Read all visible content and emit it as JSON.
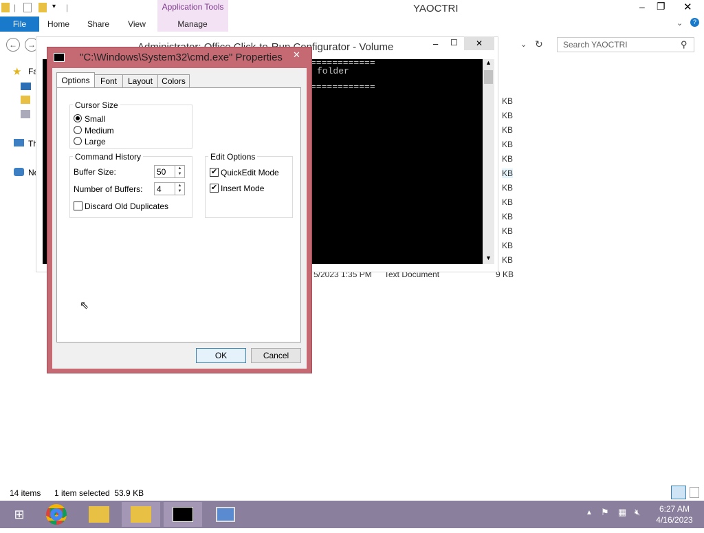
{
  "explorer": {
    "window_title": "YAOCTRI",
    "app_tools_label": "Application Tools",
    "ribbon_tabs": [
      "File",
      "Home",
      "Share",
      "View",
      "Manage"
    ],
    "search_placeholder": "Search YAOCTRI",
    "nav_items": [
      "Fa",
      "Th",
      "Ne"
    ],
    "file_sizes": [
      "KB",
      "KB",
      "KB",
      "KB",
      "KB",
      "KB",
      "KB",
      "KB",
      "KB",
      "KB",
      "KB",
      "KB"
    ],
    "visible_row": {
      "date": "5/2023 1:35 PM",
      "type": "Text Document",
      "size": "9 KB"
    },
    "status_items": "14 items",
    "status_selected": "1 item selected  53.9 KB"
  },
  "cmd_window": {
    "title": "Administrator: Office Click-to-Run Configurator - Volume",
    "lines": [
      "============",
      "folder",
      "============"
    ]
  },
  "dialog": {
    "title": "\"C:\\Windows\\System32\\cmd.exe\" Properties",
    "tabs": [
      "Options",
      "Font",
      "Layout",
      "Colors"
    ],
    "cursor_size": {
      "label": "Cursor Size",
      "options": [
        "Small",
        "Medium",
        "Large"
      ],
      "selected": "Small"
    },
    "command_history": {
      "label": "Command History",
      "buffer_size_label": "Buffer Size:",
      "buffer_size": "50",
      "num_buffers_label": "Number of Buffers:",
      "num_buffers": "4",
      "discard_label": "Discard Old Duplicates",
      "discard_checked": false
    },
    "edit_options": {
      "label": "Edit Options",
      "quickedit_label": "QuickEdit Mode",
      "quickedit_checked": true,
      "insert_label": "Insert Mode",
      "insert_checked": true
    },
    "ok_label": "OK",
    "cancel_label": "Cancel"
  },
  "taskbar": {
    "time": "6:27 AM",
    "date": "4/16/2023"
  },
  "colors": {
    "accent": "#1979ca",
    "dialog_frame": "#c56a73",
    "taskbar": "#8a7f9d"
  }
}
